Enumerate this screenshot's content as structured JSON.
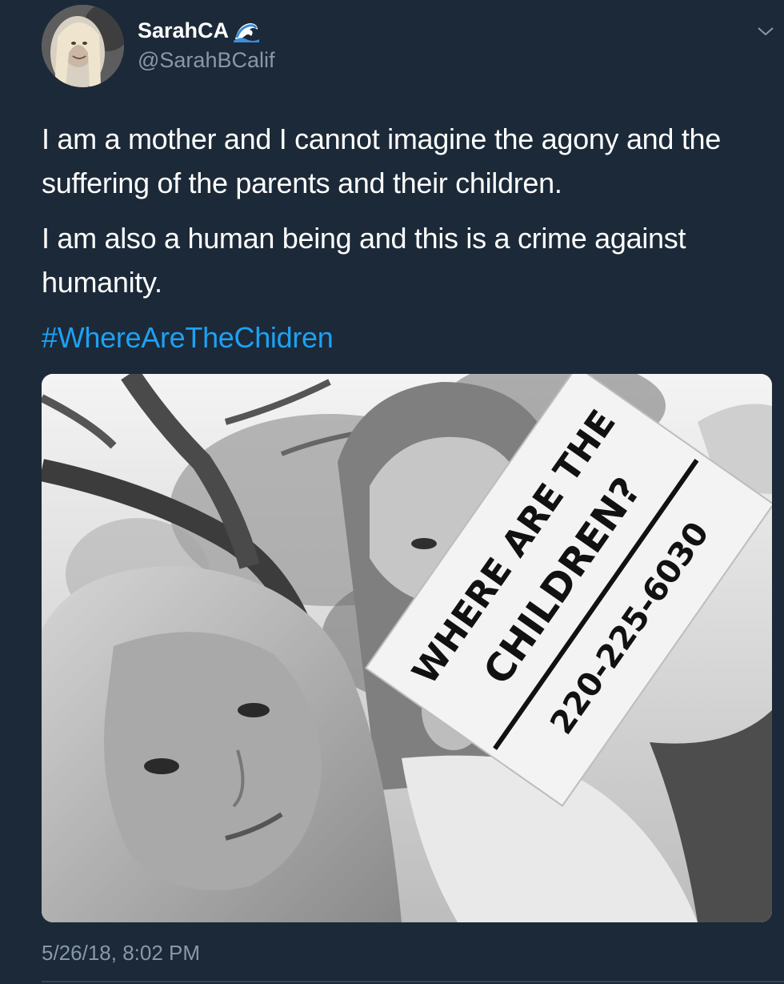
{
  "tweet": {
    "author": {
      "display_name": "SarahCA",
      "emoji_icon": "wave-emoji",
      "handle": "@SarahBCalif"
    },
    "paragraphs": [
      "I am a mother and I cannot imagine the agony and the suffering of the parents and their children.",
      "I am also a human being and this is a crime against humanity."
    ],
    "hashtag": "#WhereAreTheChidren",
    "photo": {
      "sign_line1": "WHERE ARE THE",
      "sign_line2": "CHILDREN?",
      "sign_phone": "220-225-6030"
    },
    "timestamp": "5/26/18, 8:02 PM"
  },
  "colors": {
    "background": "#1c2938",
    "text": "#ffffff",
    "secondary_text": "#8899a6",
    "link": "#1da1f2"
  },
  "icons": {
    "menu_caret": "chevron-down-icon"
  }
}
